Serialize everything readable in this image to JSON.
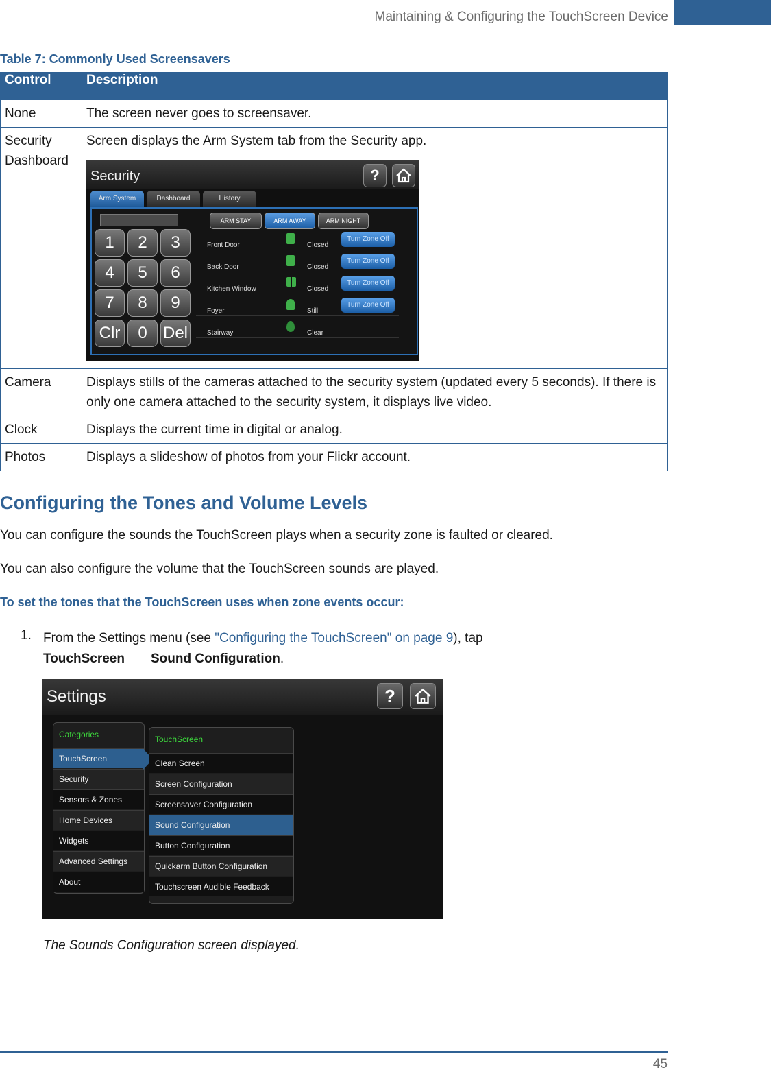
{
  "header": {
    "running_title": "Maintaining & Configuring the TouchScreen Device"
  },
  "table": {
    "caption": "Table 7:  Commonly Used Screensavers",
    "columns": [
      "Control",
      "Description"
    ],
    "rows": [
      {
        "control": "None",
        "description": "The screen never goes to screensaver."
      },
      {
        "control": "Security Dashboard",
        "description": "Screen displays the Arm System tab from the Security app."
      },
      {
        "control": "Camera",
        "description": "Displays stills of the cameras attached to the security system (updated every 5 seconds). If there is only one camera attached to the security system, it displays live video."
      },
      {
        "control": "Clock",
        "description": "Displays the current time in digital or analog."
      },
      {
        "control": "Photos",
        "description": "Displays a slideshow of photos from your Flickr account."
      }
    ]
  },
  "security_screen": {
    "title": "Security",
    "help_icon": "?",
    "tabs": [
      "Arm System",
      "Dashboard",
      "History"
    ],
    "arm_buttons": [
      "ARM STAY",
      "ARM AWAY",
      "ARM NIGHT"
    ],
    "keys": [
      "1",
      "2",
      "3",
      "4",
      "5",
      "6",
      "7",
      "8",
      "9",
      "Clr",
      "0",
      "Del"
    ],
    "zones": [
      {
        "name": "Front Door",
        "status": "Closed",
        "action": "Turn Zone Off"
      },
      {
        "name": "Back Door",
        "status": "Closed",
        "action": "Turn Zone Off"
      },
      {
        "name": "Kitchen Window",
        "status": "Closed",
        "action": "Turn Zone Off"
      },
      {
        "name": "Foyer",
        "status": "Still",
        "action": "Turn Zone Off"
      },
      {
        "name": "Stairway",
        "status": "Clear",
        "action": ""
      }
    ]
  },
  "section": {
    "heading": "Configuring the Tones and Volume Levels",
    "para1": "You can configure the sounds the TouchScreen plays when a security zone is faulted or cleared.",
    "para2": "You can also configure the volume that the TouchScreen sounds are played.",
    "procedure_title": "To set the tones that the TouchScreen uses when zone events occur:",
    "step1": {
      "number": "1.",
      "prefix": "From the Settings menu (see ",
      "link": "\"Configuring the TouchScreen\" on page 9",
      "suffix": "), tap",
      "path_part1": "TouchScreen",
      "path_part2": "Sound Configuration",
      "end": "."
    }
  },
  "settings_screen": {
    "title": "Settings",
    "help_icon": "?",
    "categories_label": "Categories",
    "categories": [
      "TouchScreen",
      "Security",
      "Sensors & Zones",
      "Home Devices",
      "Widgets",
      "Advanced Settings",
      "About"
    ],
    "menu_label": "TouchScreen",
    "menu_items": [
      "Clean Screen",
      "Screen Configuration",
      "Screensaver Configuration",
      "Sound Configuration",
      "Button Configuration",
      "Quickarm Button Configuration",
      "Touchscreen Audible Feedback"
    ]
  },
  "caption": "The Sounds Configuration screen displayed.",
  "footer": {
    "page_number": "45"
  }
}
